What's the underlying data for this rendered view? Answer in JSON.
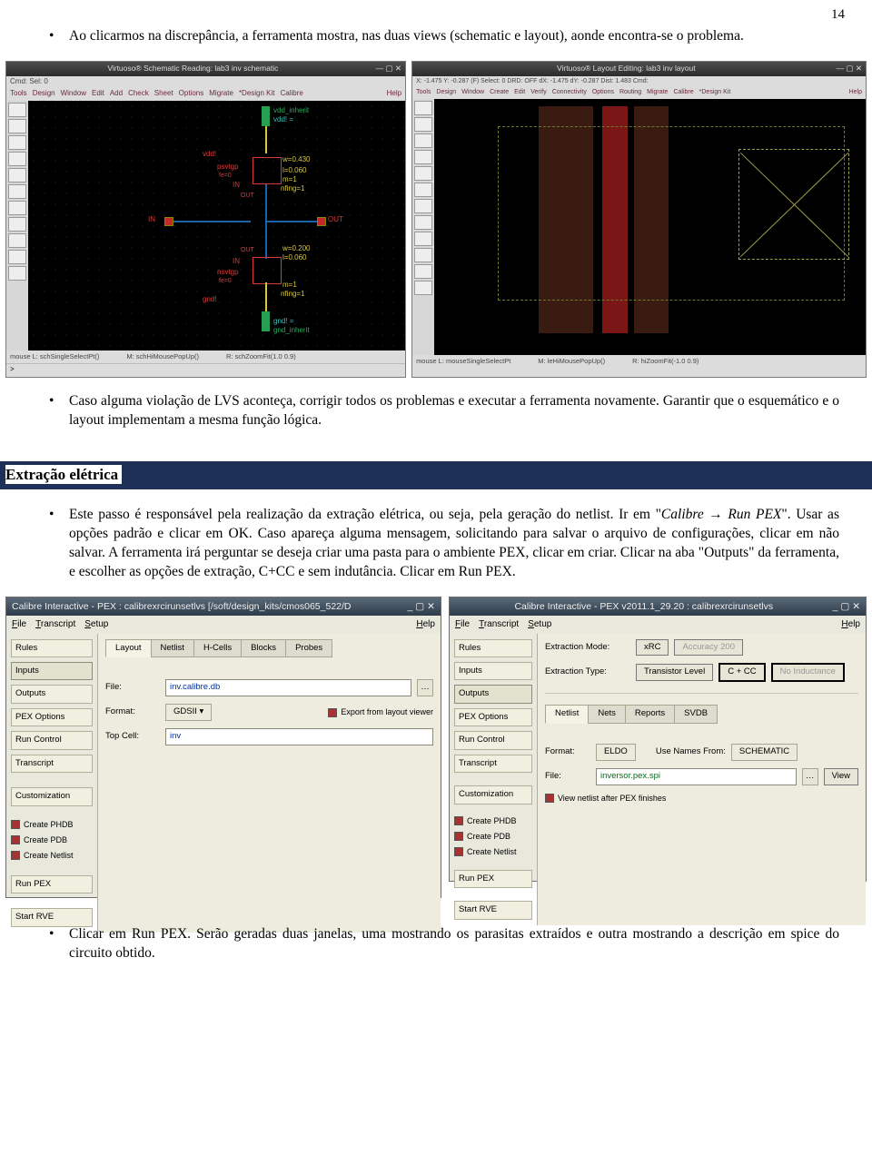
{
  "page_number": "14",
  "para1": "Ao clicarmos na discrepância, a ferramenta mostra, nas duas views (schematic e layout), aonde encontra-se o problema.",
  "para2": "Caso alguma violação de LVS aconteça, corrigir todos os problemas e executar a ferramenta novamente. Garantir que o esquemático e o layout implementam a mesma função lógica.",
  "section_title": "Extração elétrica",
  "para3_a": "Este passo é responsável pela realização da extração elétrica, ou seja, pela geração do netlist. Ir em \"",
  "para3_ital": "Calibre → Run PEX",
  "para3_b": "\". Usar as opções padrão e clicar em OK. Caso apareça alguma mensagem, solicitando para salvar o arquivo de configurações, clicar em não salvar. A ferramenta irá perguntar se deseja criar uma pasta para o ambiente PEX, clicar em criar. Clicar na aba \"Outputs\" da ferramenta, e escolher as opções de extração, C+CC e sem indutância. Clicar em Run PEX.",
  "para4": "Clicar em Run PEX. Serão geradas duas janelas, uma mostrando os parasitas extraídos e outra mostrando a descrição em spice do circuito obtido.",
  "virtuoso_schematic": {
    "title": "Virtuoso® Schematic Reading: lab3 inv schematic",
    "cmd_line": "Cmd:          Sel: 0",
    "menu": [
      "Tools",
      "Design",
      "Window",
      "Edit",
      "Add",
      "Check",
      "Sheet",
      "Options",
      "Migrate",
      "*Design Kit",
      "Calibre"
    ],
    "help": "Help",
    "labels": {
      "vdd_inherit": "vdd_inherit",
      "vdd_net": "vdd! =",
      "vdd": "vdd!",
      "pmos_inst": "psvtgp",
      "w430": "w=0.430",
      "l060_1": "l=0.060",
      "m1_1": "m=1",
      "nfing1": "nfing=1",
      "in_pin": "IN",
      "out_pin": "OUT",
      "in_left": "IN",
      "out_right": "OUT",
      "nmos_inst": "nsvtgp",
      "w200": "w=0.200",
      "l060_2": "l=0.060",
      "m1_2": "m=1",
      "nfing2": "nfing=1",
      "gnd": "gnd!",
      "gnd_net": "gnd! =",
      "gnd_inherit": "gnd_inherit",
      "fe9_1": "fe=0",
      "fe9_2": "fe=0"
    },
    "status": {
      "l": "mouse L: schSingleSelectPt()",
      "m": "M: schHiMousePopUp()",
      "r": "R: schZoomFit(1.0 0.9)"
    }
  },
  "virtuoso_layout": {
    "title": "Virtuoso® Layout Editing: lab3 inv layout",
    "info_line": "X: -1.475   Y: -0.287   (F) Select: 0   DRD: OFF   dX: -1.475   dY: -0.287   Dist: 1.483   Cmd:",
    "menu": [
      "Tools",
      "Design",
      "Window",
      "Create",
      "Edit",
      "Verify",
      "Connectivity",
      "Options",
      "Routing",
      "Migrate",
      "Calibre",
      "*Design Kit"
    ],
    "help": "Help",
    "status": {
      "l": "mouse L: mouseSingleSelectPt",
      "m": "M: leHiMousePopUp()",
      "r": "R: hiZoomFit(-1.0 0.9)"
    }
  },
  "calibre_inputs": {
    "title": "Calibre Interactive - PEX : calibrexrcirunsetlvs [/soft/design_kits/cmos065_522/D",
    "menu": {
      "file": "File",
      "transcript": "Transcript",
      "setup": "Setup",
      "help": "Help"
    },
    "side": {
      "rules": "Rules",
      "inputs": "Inputs",
      "outputs": "Outputs",
      "pex": "PEX Options",
      "runc": "Run Control",
      "transcript": "Transcript",
      "cust": "Customization",
      "phdb": "Create PHDB",
      "pdb": "Create PDB",
      "netlist": "Create Netlist",
      "runpex": "Run PEX",
      "startrve": "Start RVE"
    },
    "tabs": {
      "layout": "Layout",
      "netlist": "Netlist",
      "hcells": "H-Cells",
      "blocks": "Blocks",
      "probes": "Probes"
    },
    "file_lbl": "File:",
    "file_val": "inv.calibre.db",
    "format_lbl": "Format:",
    "format_val": "GDSII",
    "export_chk": "Export from layout viewer",
    "top_lbl": "Top Cell:",
    "top_val": "inv"
  },
  "calibre_outputs": {
    "title": "Calibre Interactive - PEX v2011.1_29.20 :  calibrexrcirunsetlvs",
    "menu": {
      "file": "File",
      "transcript": "Transcript",
      "setup": "Setup",
      "help": "Help"
    },
    "side": {
      "rules": "Rules",
      "inputs": "Inputs",
      "outputs": "Outputs",
      "pex": "PEX Options",
      "runc": "Run Control",
      "transcript": "Transcript",
      "cust": "Customization",
      "phdb": "Create PHDB",
      "pdb": "Create PDB",
      "netlist": "Create Netlist",
      "runpex": "Run PEX",
      "startrve": "Start RVE"
    },
    "mode_lbl": "Extraction Mode:",
    "mode_val": "xRC",
    "mode_acc": "Accuracy 200",
    "type_lbl": "Extraction Type:",
    "type_val": "Transistor Level",
    "type_ccc": "C + CC",
    "type_ind": "No Inductance",
    "tabs": {
      "netlist": "Netlist",
      "nets": "Nets",
      "reports": "Reports",
      "svdb": "SVDB"
    },
    "fmt_lbl": "Format:",
    "fmt_val": "ELDO",
    "usenames_lbl": "Use Names From:",
    "usenames_val": "SCHEMATIC",
    "file_lbl": "File:",
    "file_val": "inversor.pex.spi",
    "view_btn": "View",
    "viewafter": "View netlist after PEX finishes"
  }
}
